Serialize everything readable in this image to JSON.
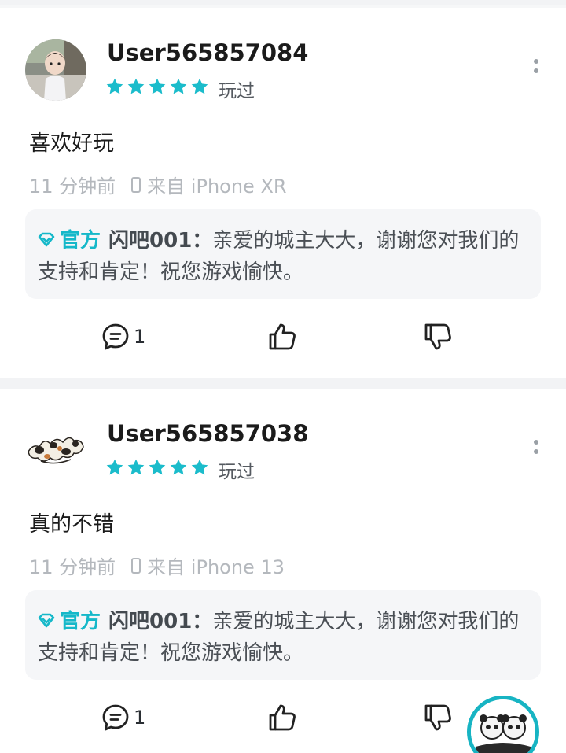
{
  "reviews": [
    {
      "username": "User565857084",
      "rating": 5,
      "status": "玩过",
      "content": "喜欢好玩",
      "time": "11 分钟前",
      "device": "来自 iPhone XR",
      "reply": {
        "badge": "官方",
        "author": "闪吧001",
        "separator": "：",
        "text": "亲爱的城主大大，谢谢您对我们的支持和肯定！祝您游戏愉快。"
      },
      "comment_count": "1"
    },
    {
      "username": "User565857038",
      "rating": 5,
      "status": "玩过",
      "content": "真的不错",
      "time": "11 分钟前",
      "device": "来自 iPhone 13",
      "reply": {
        "badge": "官方",
        "author": "闪吧001",
        "separator": "：",
        "text": "亲爱的城主大大，谢谢您对我们的支持和肯定！祝您游戏愉快。"
      },
      "comment_count": "1"
    }
  ],
  "colors": {
    "accent": "#15b8c9",
    "star": "#1bbccb",
    "meta": "#b4b8bd",
    "reply_bg": "#f5f6f8"
  },
  "icons": {
    "more": "more-vertical-icon",
    "device": "phone-icon",
    "official": "diamond-badge-icon",
    "comment": "comment-icon",
    "like": "thumbs-up-icon",
    "dislike": "thumbs-down-icon"
  }
}
